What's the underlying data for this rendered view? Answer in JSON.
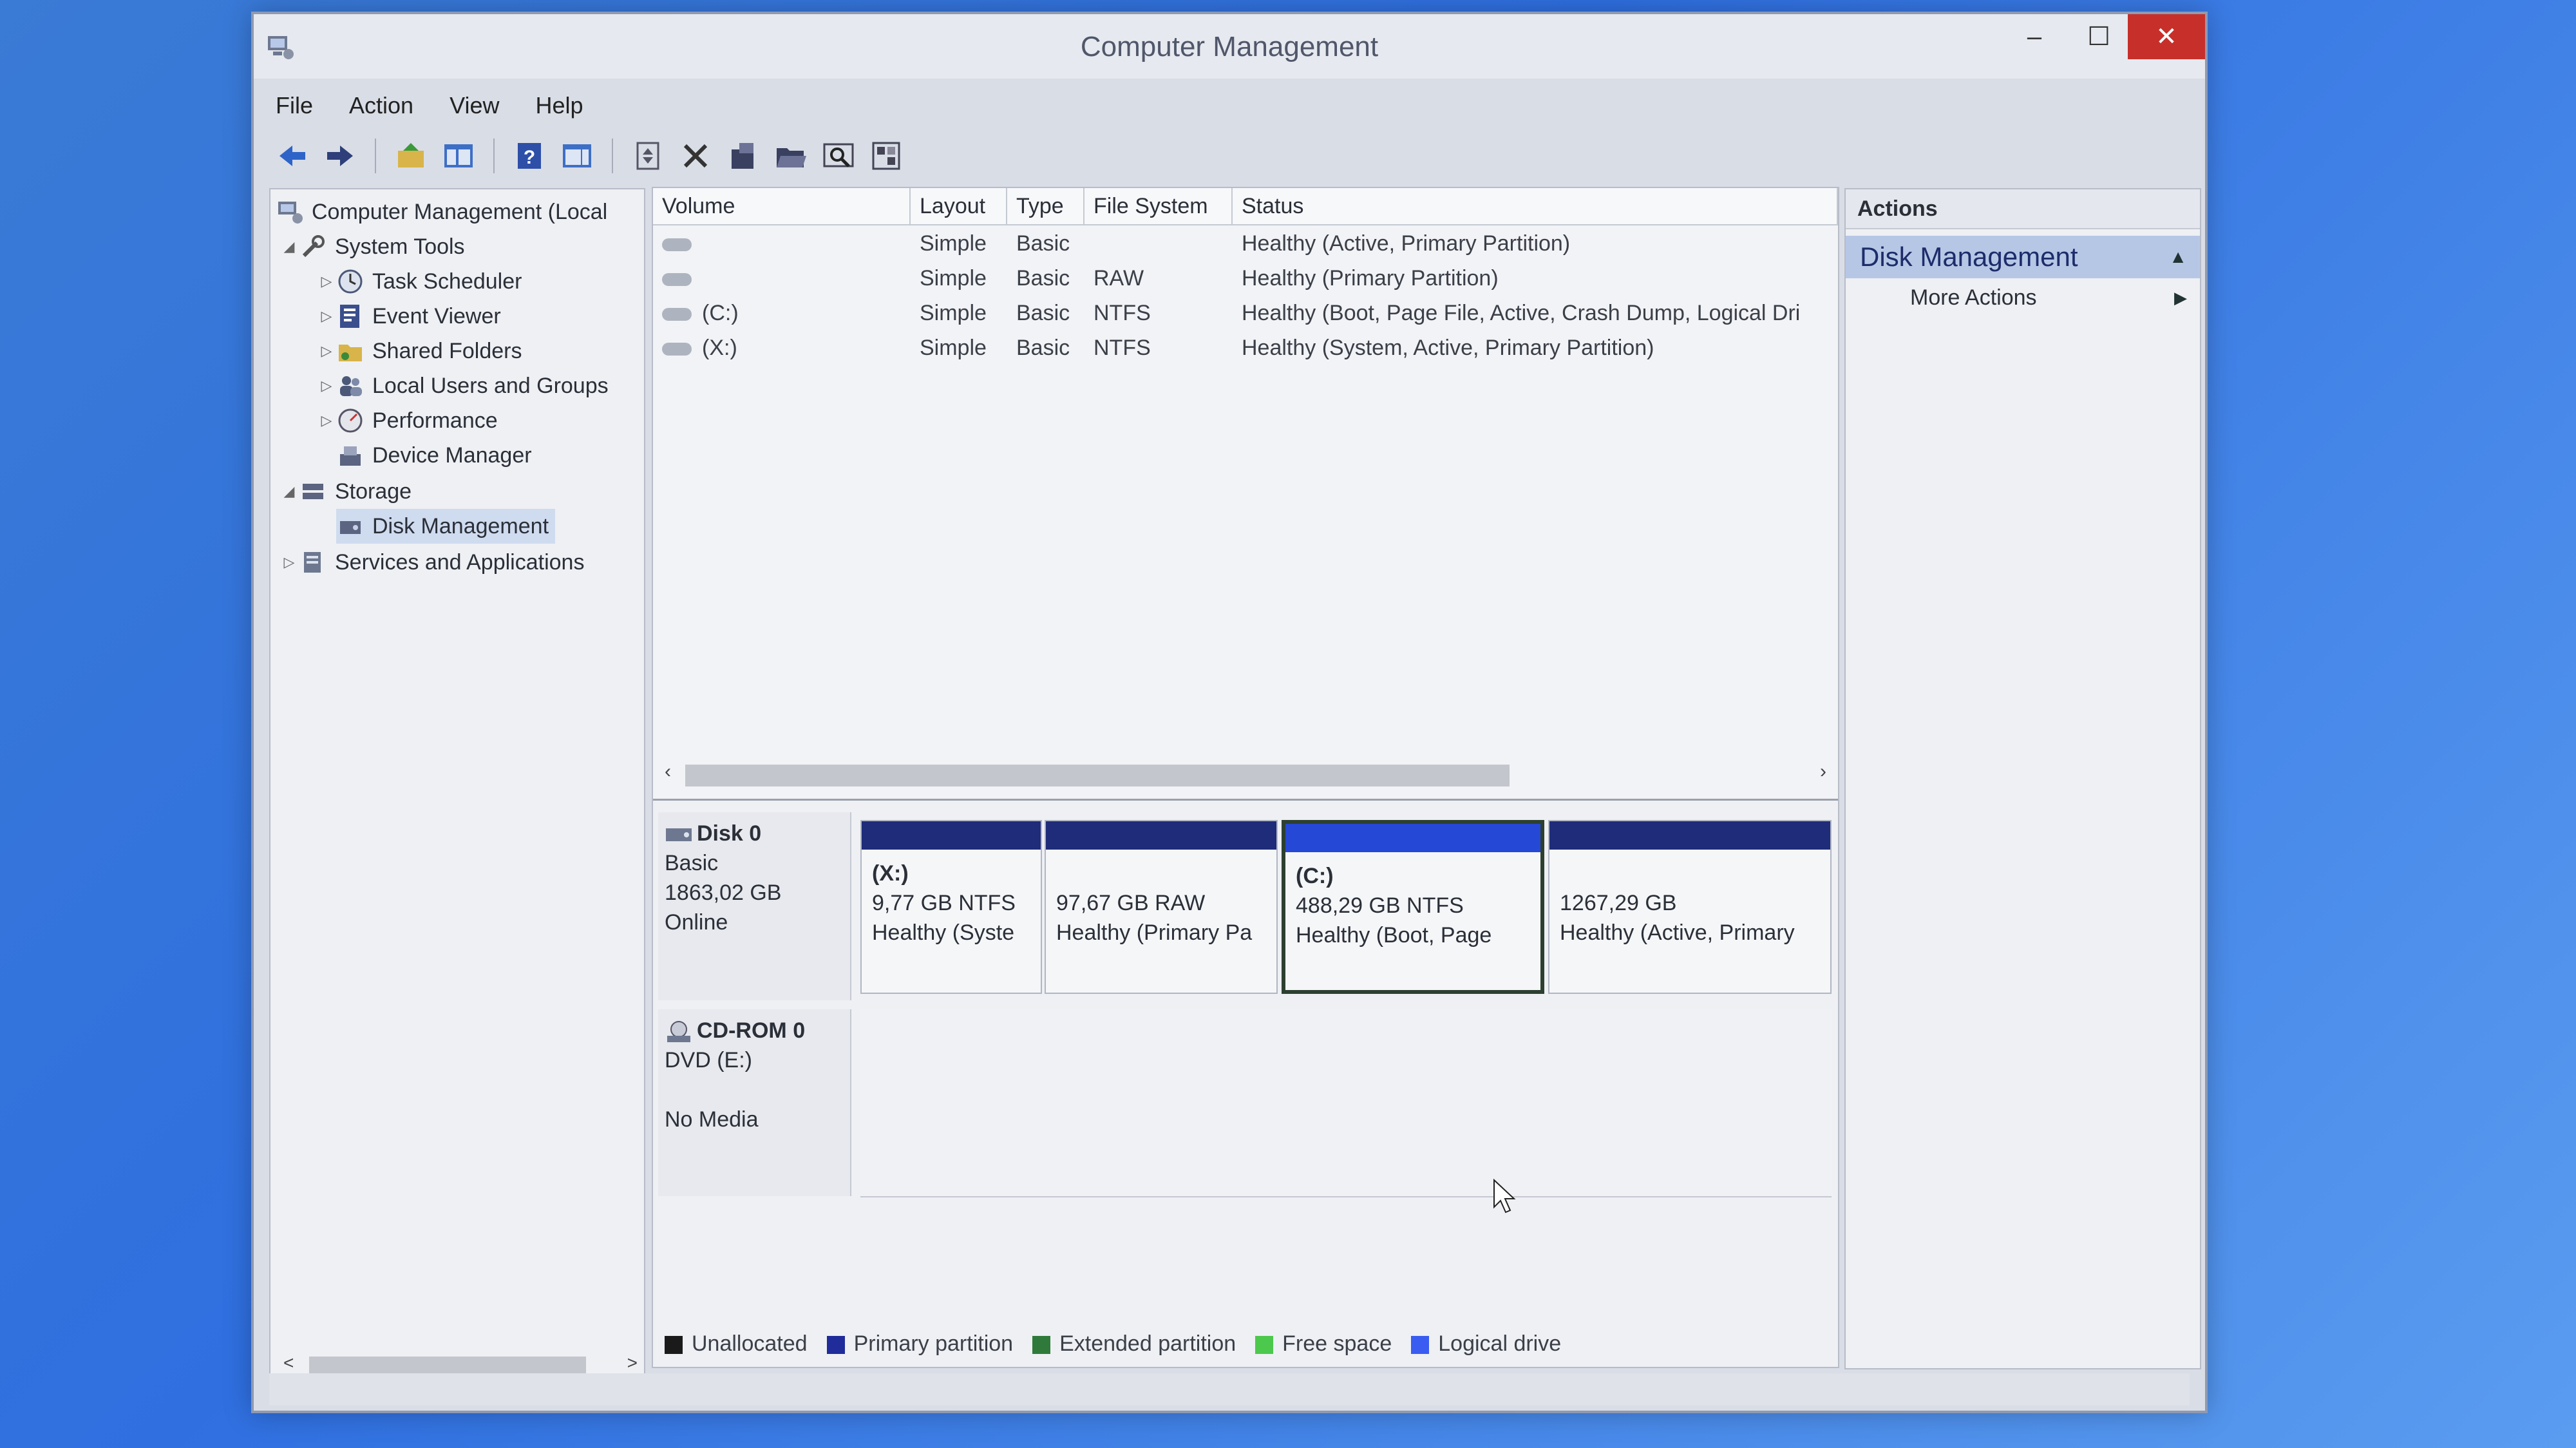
{
  "window": {
    "title": "Computer Management",
    "minimize": "–",
    "maximize": "☐",
    "close": "✕"
  },
  "menu": {
    "file": "File",
    "action": "Action",
    "view": "View",
    "help": "Help"
  },
  "tree": {
    "root": "Computer Management (Local",
    "system_tools": "System Tools",
    "task_scheduler": "Task Scheduler",
    "event_viewer": "Event Viewer",
    "shared_folders": "Shared Folders",
    "local_users": "Local Users and Groups",
    "performance": "Performance",
    "device_manager": "Device Manager",
    "storage": "Storage",
    "disk_management": "Disk Management",
    "services": "Services and Applications"
  },
  "volume_table": {
    "headers": {
      "volume": "Volume",
      "layout": "Layout",
      "type": "Type",
      "fs": "File System",
      "status": "Status"
    },
    "rows": [
      {
        "volume": "",
        "layout": "Simple",
        "type": "Basic",
        "fs": "",
        "status": "Healthy (Active, Primary Partition)"
      },
      {
        "volume": "",
        "layout": "Simple",
        "type": "Basic",
        "fs": "RAW",
        "status": "Healthy (Primary Partition)"
      },
      {
        "volume": "(C:)",
        "layout": "Simple",
        "type": "Basic",
        "fs": "NTFS",
        "status": "Healthy (Boot, Page File, Active, Crash Dump, Logical Dri"
      },
      {
        "volume": "(X:)",
        "layout": "Simple",
        "type": "Basic",
        "fs": "NTFS",
        "status": "Healthy (System, Active, Primary Partition)"
      }
    ]
  },
  "disk0": {
    "name": "Disk 0",
    "type": "Basic",
    "size": "1863,02 GB",
    "state": "Online",
    "partitions": [
      {
        "name": "(X:)",
        "size": "9,77 GB NTFS",
        "status": "Healthy (Syste"
      },
      {
        "name": "",
        "size": "97,67 GB RAW",
        "status": "Healthy (Primary Pa"
      },
      {
        "name": "(C:)",
        "size": "488,29 GB NTFS",
        "status": "Healthy (Boot, Page"
      },
      {
        "name": "",
        "size": "1267,29 GB",
        "status": "Healthy (Active, Primary"
      }
    ]
  },
  "cdrom0": {
    "name": "CD-ROM 0",
    "type": "DVD (E:)",
    "state": "No Media"
  },
  "legend": {
    "unallocated": "Unallocated",
    "primary": "Primary partition",
    "extended": "Extended partition",
    "free": "Free space",
    "logical": "Logical drive"
  },
  "actions": {
    "header": "Actions",
    "section": "Disk Management",
    "more": "More Actions"
  },
  "colors": {
    "unallocated": "#1a1a1a",
    "primary": "#1f2c9a",
    "extended": "#2f7a3a",
    "free": "#4cc84c",
    "logical": "#3a5cf0"
  }
}
